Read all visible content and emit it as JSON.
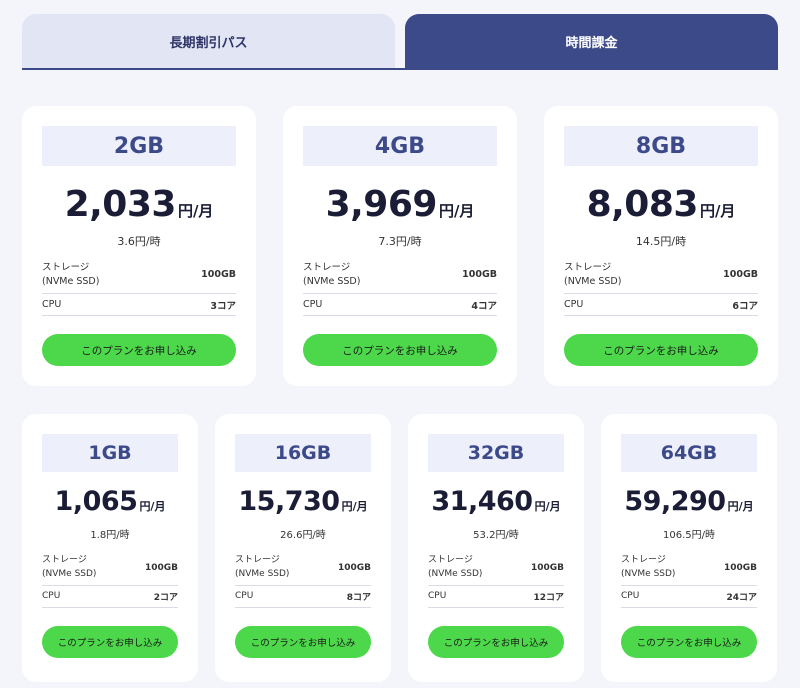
{
  "tabs": {
    "long_term": "長期割引パス",
    "hourly": "時間課金"
  },
  "common": {
    "storage_label_line1": "ストレージ",
    "storage_label_line2": "(NVMe SSD)",
    "cpu_label": "CPU",
    "button_label": "このプランをお申し込み",
    "price_unit": "円/月"
  },
  "colors": {
    "accent": "#3d4a8a",
    "button": "#4cd84a",
    "background": "#f3f5fb"
  },
  "plans": [
    {
      "name": "2GB",
      "price": "2,033",
      "hourly": "3.6円/時",
      "storage": "100GB",
      "cpu": "3コア"
    },
    {
      "name": "4GB",
      "price": "3,969",
      "hourly": "7.3円/時",
      "storage": "100GB",
      "cpu": "4コア"
    },
    {
      "name": "8GB",
      "price": "8,083",
      "hourly": "14.5円/時",
      "storage": "100GB",
      "cpu": "6コア"
    },
    {
      "name": "1GB",
      "price": "1,065",
      "hourly": "1.8円/時",
      "storage": "100GB",
      "cpu": "2コア"
    },
    {
      "name": "16GB",
      "price": "15,730",
      "hourly": "26.6円/時",
      "storage": "100GB",
      "cpu": "8コア"
    },
    {
      "name": "32GB",
      "price": "31,460",
      "hourly": "53.2円/時",
      "storage": "100GB",
      "cpu": "12コア"
    },
    {
      "name": "64GB",
      "price": "59,290",
      "hourly": "106.5円/時",
      "storage": "100GB",
      "cpu": "24コア"
    }
  ]
}
